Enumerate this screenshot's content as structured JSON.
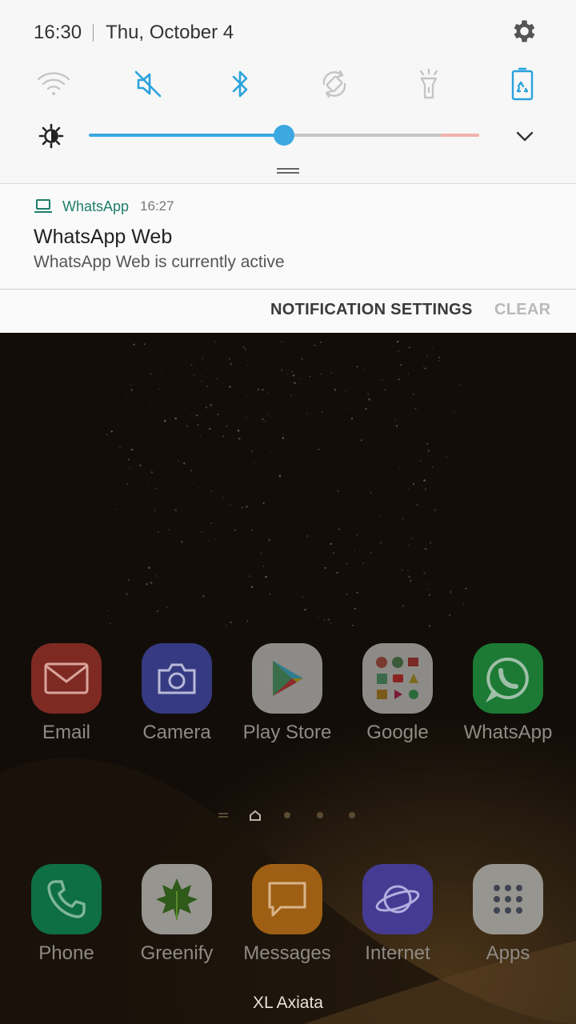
{
  "status": {
    "time": "16:30",
    "date": "Thu, October 4"
  },
  "quick_settings": [
    {
      "name": "wifi",
      "active": false,
      "icon": "wifi-icon"
    },
    {
      "name": "sound",
      "active": true,
      "icon": "mute-icon"
    },
    {
      "name": "bluetooth",
      "active": true,
      "icon": "bluetooth-icon"
    },
    {
      "name": "auto-rotate",
      "active": false,
      "icon": "rotate-icon"
    },
    {
      "name": "flashlight",
      "active": false,
      "icon": "flashlight-icon"
    },
    {
      "name": "power-saving",
      "active": true,
      "icon": "battery-saver-icon"
    }
  ],
  "brightness": {
    "level": 0.5
  },
  "notification": {
    "app": "WhatsApp",
    "time": "16:27",
    "title": "WhatsApp Web",
    "text": "WhatsApp Web is currently active"
  },
  "actions": {
    "settings_label": "NOTIFICATION SETTINGS",
    "clear_label": "CLEAR"
  },
  "home_apps_row1": [
    {
      "label": "Email",
      "icon": "email-icon",
      "color": "#8c2b22"
    },
    {
      "label": "Camera",
      "icon": "camera-icon",
      "color": "#3a3f8a"
    },
    {
      "label": "Play Store",
      "icon": "play-store-icon",
      "color": "#9a9894"
    },
    {
      "label": "Google",
      "icon": "google-folder-icon",
      "color": "#9a9894"
    },
    {
      "label": "WhatsApp",
      "icon": "whatsapp-icon",
      "color": "#1f8a3a"
    }
  ],
  "home_apps_dock": [
    {
      "label": "Phone",
      "icon": "phone-icon",
      "color": "#0f7a4a"
    },
    {
      "label": "Greenify",
      "icon": "greenify-icon",
      "color": "#a8a6a0"
    },
    {
      "label": "Messages",
      "icon": "messages-icon",
      "color": "#b06a16"
    },
    {
      "label": "Internet",
      "icon": "internet-icon",
      "color": "#4a3f9e"
    },
    {
      "label": "Apps",
      "icon": "apps-grid-icon",
      "color": "#a8a6a0"
    }
  ],
  "carrier": "XL Axiata",
  "colors": {
    "accent": "#3ba8e0",
    "whatsapp_green": "#1e7d69"
  }
}
